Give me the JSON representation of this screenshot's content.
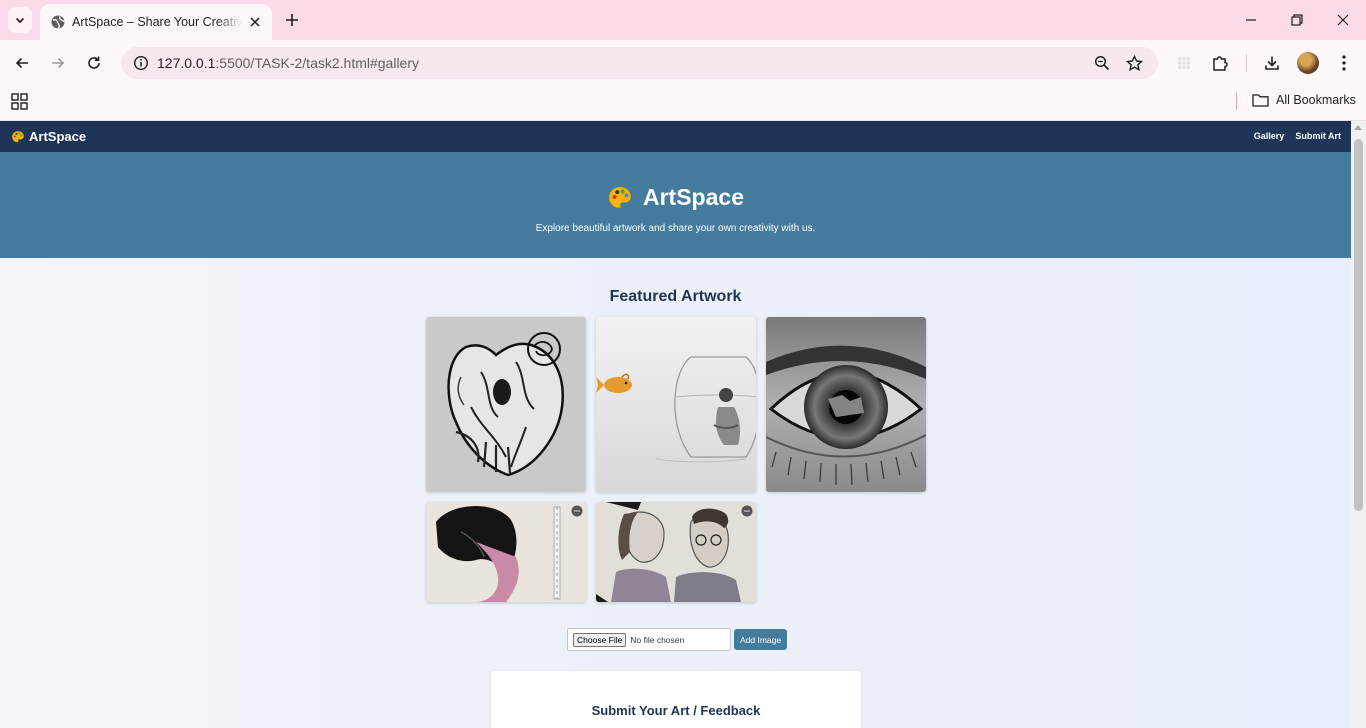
{
  "browser": {
    "tab_title": "ArtSpace – Share Your Creativity",
    "url_host": "127.0.0.1",
    "url_rest": ":5500/TASK-2/task2.html#gallery",
    "bookmarks_label": "All Bookmarks"
  },
  "site": {
    "brand": "ArtSpace",
    "nav": [
      "Gallery",
      "Submit Art"
    ],
    "hero_title": "ArtSpace",
    "hero_subtitle": "Explore beautiful artwork and share your own creativity with us.",
    "gallery_title": "Featured Artwork",
    "artworks": [
      {
        "subject": "anatomical heart with rose sketch"
      },
      {
        "subject": "goldfish and girl in fishbowl sketch"
      },
      {
        "subject": "realistic eye with reflection drawing"
      },
      {
        "subject": "woman with dark hair and pencil drawing"
      },
      {
        "subject": "couple portrait sketch"
      }
    ],
    "upload": {
      "choose_label": "Choose File",
      "no_file_text": "No file chosen",
      "add_label": "Add Image"
    },
    "form_title": "Submit Your Art / Feedback"
  },
  "colors": {
    "nav_bg": "#1e3557",
    "hero_bg": "#457b9d",
    "accent": "#457b9d"
  }
}
